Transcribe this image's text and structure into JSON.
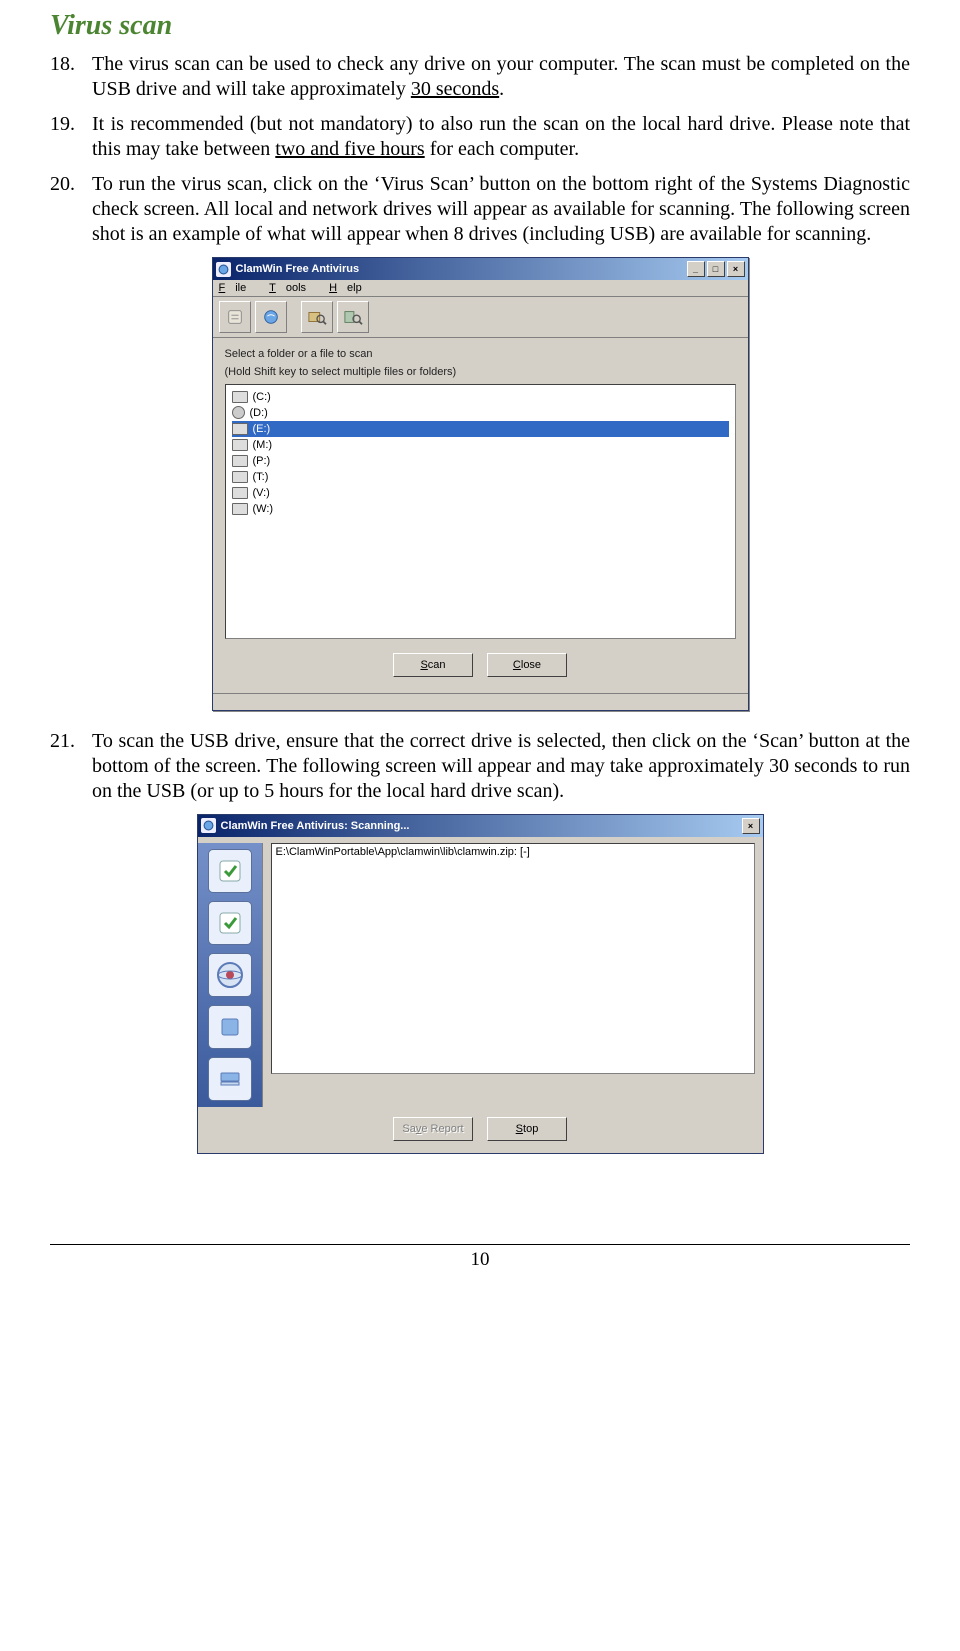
{
  "heading": "Virus scan",
  "para18": {
    "num": "18.",
    "pre": "The virus scan can be used to check any drive on your computer. The scan must be completed on the USB drive and will take approximately ",
    "u": "30 seconds",
    "post": "."
  },
  "para19": {
    "num": "19.",
    "pre": "It is recommended (but not mandatory) to also run the scan on the local hard drive. Please note that this may take between ",
    "u": "two and five hours",
    "post": " for each computer."
  },
  "para20": {
    "num": "20.",
    "text": "To run the virus scan, click on the ‘Virus Scan’ button on the bottom right of the Systems Diagnostic check screen. All local and network drives will appear as available for scanning. The following screen shot is an example of what will appear when 8 drives (including USB) are available for scanning."
  },
  "para21": {
    "num": "21.",
    "text": "To scan the USB drive, ensure that the correct drive is selected, then click on the ‘Scan’ button at the bottom of the screen. The following screen will appear and may take approximately 30 seconds to run on the USB (or up to 5 hours for the local hard drive scan)."
  },
  "win1": {
    "title": "ClamWin Free Antivirus",
    "menu": {
      "file_k": "F",
      "file_r": "ile",
      "tools_k": "T",
      "tools_r": "ools",
      "help_k": "H",
      "help_r": "elp"
    },
    "instr1": "Select a folder or a file to scan",
    "instr2": "(Hold Shift key to select multiple files or folders)",
    "drives": [
      "(C:)",
      "(D:)",
      "(E:)",
      "(M:)",
      "(P:)",
      "(T:)",
      "(V:)",
      "(W:)"
    ],
    "scan_k": "S",
    "scan_r": "can",
    "close_k": "C",
    "close_r": "lose"
  },
  "win2": {
    "title": "ClamWin Free Antivirus: Scanning...",
    "path": "E:\\ClamWinPortable\\App\\clamwin\\lib\\clamwin.zip: [-]",
    "save_pre": "Sa",
    "save_k": "v",
    "save_post": "e Report",
    "stop_k": "S",
    "stop_r": "top"
  },
  "pageno": "10"
}
